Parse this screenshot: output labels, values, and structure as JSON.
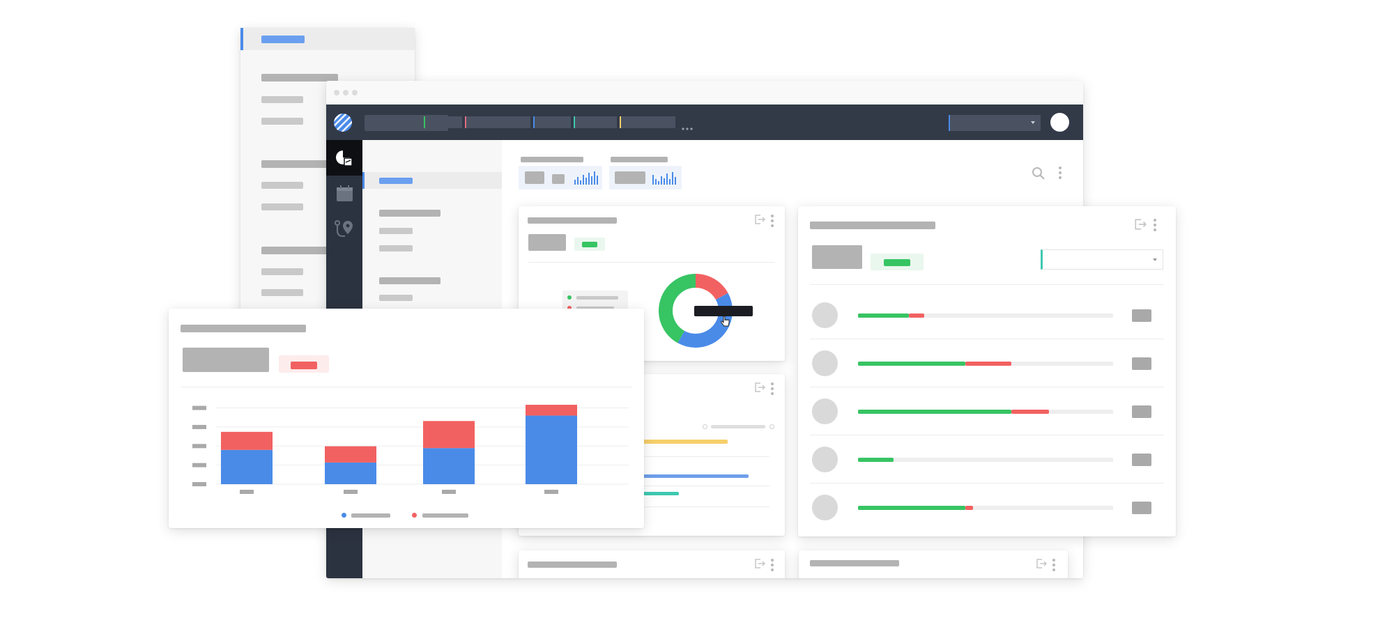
{
  "window": {
    "traffic_lights": [
      "close",
      "minimize",
      "maximize"
    ]
  },
  "colors": {
    "navbar": "#323a48",
    "sidebar": "#2c3340",
    "active_icon_bg": "#0d0f13",
    "accent_blue": "#4a8be8",
    "green": "#37c463",
    "red": "#f26161",
    "yellow": "#f6cf6b",
    "teal": "#3fc9b1",
    "pink": "#e06c83",
    "tooltip": "#1b1d22"
  },
  "navbar": {
    "logo": "striped-globe-icon",
    "dropdown_icon": "chevron-down-icon",
    "tab_accents": [
      "#37c463",
      "#e06c83",
      "#4a8be8",
      "#3fc9b1",
      "#f6cf6b"
    ],
    "more_icon": "ellipsis-icon",
    "profile_icon": "avatar"
  },
  "sidebar_icons": [
    "pie-chart-icon",
    "calendar-icon",
    "route-pin-icon"
  ],
  "toolbar": {
    "search_icon": "search-icon",
    "menu_icon": "kebab-menu-icon"
  },
  "donut_card": {
    "segments": [
      {
        "color": "#f26161",
        "fraction": 0.17
      },
      {
        "color": "#4a8be8",
        "fraction": 0.41
      },
      {
        "color": "#37c463",
        "fraction": 0.42
      }
    ],
    "cursor_icon": "hand-pointer-icon"
  },
  "progress_card": {
    "rows": [
      {
        "green": 0.2,
        "red": 0.06
      },
      {
        "green": 0.42,
        "red": 0.18
      },
      {
        "green": 0.6,
        "red": 0.15
      },
      {
        "green": 0.14,
        "red": 0
      },
      {
        "green": 0.42,
        "red": 0.03
      }
    ]
  },
  "chart_data": {
    "type": "bar",
    "stacked": true,
    "categories": [
      "",
      "",
      "",
      ""
    ],
    "series": [
      {
        "color": "#4a8be8",
        "values": [
          19,
          12,
          20,
          38
        ]
      },
      {
        "color": "#f26161",
        "values": [
          10,
          9,
          15,
          6
        ]
      }
    ],
    "ylim": [
      0,
      44
    ],
    "grid": true,
    "legend": "bottom"
  }
}
